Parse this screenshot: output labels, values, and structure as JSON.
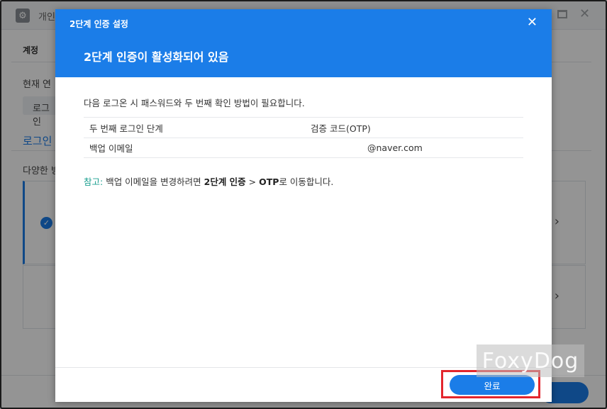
{
  "background": {
    "window_title": "개인",
    "tab": "계정",
    "current_label": "현재 연",
    "login_button": "로그인",
    "section_title": "로그인",
    "various_label": "다양한 방",
    "chevron": "›"
  },
  "dialog": {
    "title": "2단계 인증 설정",
    "close": "✕",
    "heading": "2단계 인증이 활성화되어 있음",
    "description": "다음 로그온 시 패스워드와 두 번째 확인 방법이 필요합니다.",
    "table": [
      {
        "label": "두 번째 로그인 단계",
        "value": "검증 코드(OTP)"
      },
      {
        "label": "백업 이메일",
        "value": "@naver.com"
      }
    ],
    "note": {
      "label": "참고:",
      "text1": " 백업 이메일을 변경하려면 ",
      "bold1": "2단계 인증",
      "text2": " > ",
      "bold2": "OTP",
      "text3": "로 이동합니다."
    },
    "done_button": "완료"
  },
  "watermark": "FoxyDog",
  "colors": {
    "accent": "#1b7de8",
    "highlight": "#e3262d",
    "note_label": "#1a9f8f"
  }
}
